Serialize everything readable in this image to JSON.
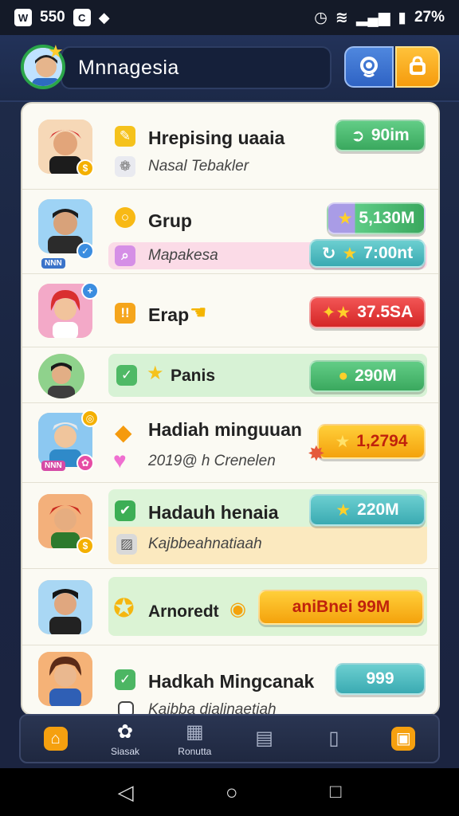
{
  "status": {
    "time": "550",
    "battery": "27%"
  },
  "header": {
    "username": "Mnnagesia"
  },
  "rows": [
    {
      "title": "Hrepising uaaia",
      "subtitle": "Nasal Tebakler",
      "value": "90im"
    },
    {
      "title": "Grup",
      "subtitle": "Mapakesa",
      "value": "5,130M",
      "value2": "7:00nt",
      "badge": "NNN"
    },
    {
      "title": "Erap",
      "value": "37.5SA"
    },
    {
      "title": "Panis",
      "value": "290M"
    },
    {
      "title": "Hadiah minguuan",
      "subtitle": "2019@ h Crenelen",
      "value": "1,2794",
      "badge": "NNN"
    },
    {
      "title": "Hadauh henaia",
      "subtitle": "Kajbbeahnatiaah",
      "value": "220M"
    },
    {
      "title": "Arnoredt",
      "value": "aniBnei 99M"
    },
    {
      "title": "Hadkah Mingcanak",
      "subtitle": "Kaibba dialinaetiah",
      "value": "999"
    }
  ],
  "nav": {
    "item2": "Siasak",
    "item3": "Ronutta"
  },
  "colors": {
    "green": "#3aa85e",
    "teal": "#3aaab2",
    "red": "#d42626",
    "orange": "#f4a20c",
    "panel": "#fbfaf3"
  }
}
